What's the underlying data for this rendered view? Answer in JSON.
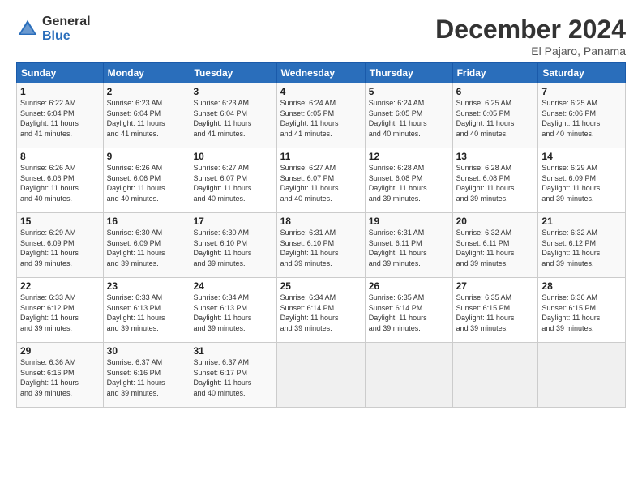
{
  "logo": {
    "general": "General",
    "blue": "Blue"
  },
  "header": {
    "month": "December 2024",
    "location": "El Pajaro, Panama"
  },
  "days_of_week": [
    "Sunday",
    "Monday",
    "Tuesday",
    "Wednesday",
    "Thursday",
    "Friday",
    "Saturday"
  ],
  "weeks": [
    [
      {
        "day": "1",
        "info": "Sunrise: 6:22 AM\nSunset: 6:04 PM\nDaylight: 11 hours\nand 41 minutes."
      },
      {
        "day": "2",
        "info": "Sunrise: 6:23 AM\nSunset: 6:04 PM\nDaylight: 11 hours\nand 41 minutes."
      },
      {
        "day": "3",
        "info": "Sunrise: 6:23 AM\nSunset: 6:04 PM\nDaylight: 11 hours\nand 41 minutes."
      },
      {
        "day": "4",
        "info": "Sunrise: 6:24 AM\nSunset: 6:05 PM\nDaylight: 11 hours\nand 41 minutes."
      },
      {
        "day": "5",
        "info": "Sunrise: 6:24 AM\nSunset: 6:05 PM\nDaylight: 11 hours\nand 40 minutes."
      },
      {
        "day": "6",
        "info": "Sunrise: 6:25 AM\nSunset: 6:05 PM\nDaylight: 11 hours\nand 40 minutes."
      },
      {
        "day": "7",
        "info": "Sunrise: 6:25 AM\nSunset: 6:06 PM\nDaylight: 11 hours\nand 40 minutes."
      }
    ],
    [
      {
        "day": "8",
        "info": "Sunrise: 6:26 AM\nSunset: 6:06 PM\nDaylight: 11 hours\nand 40 minutes."
      },
      {
        "day": "9",
        "info": "Sunrise: 6:26 AM\nSunset: 6:06 PM\nDaylight: 11 hours\nand 40 minutes."
      },
      {
        "day": "10",
        "info": "Sunrise: 6:27 AM\nSunset: 6:07 PM\nDaylight: 11 hours\nand 40 minutes."
      },
      {
        "day": "11",
        "info": "Sunrise: 6:27 AM\nSunset: 6:07 PM\nDaylight: 11 hours\nand 40 minutes."
      },
      {
        "day": "12",
        "info": "Sunrise: 6:28 AM\nSunset: 6:08 PM\nDaylight: 11 hours\nand 39 minutes."
      },
      {
        "day": "13",
        "info": "Sunrise: 6:28 AM\nSunset: 6:08 PM\nDaylight: 11 hours\nand 39 minutes."
      },
      {
        "day": "14",
        "info": "Sunrise: 6:29 AM\nSunset: 6:09 PM\nDaylight: 11 hours\nand 39 minutes."
      }
    ],
    [
      {
        "day": "15",
        "info": "Sunrise: 6:29 AM\nSunset: 6:09 PM\nDaylight: 11 hours\nand 39 minutes."
      },
      {
        "day": "16",
        "info": "Sunrise: 6:30 AM\nSunset: 6:09 PM\nDaylight: 11 hours\nand 39 minutes."
      },
      {
        "day": "17",
        "info": "Sunrise: 6:30 AM\nSunset: 6:10 PM\nDaylight: 11 hours\nand 39 minutes."
      },
      {
        "day": "18",
        "info": "Sunrise: 6:31 AM\nSunset: 6:10 PM\nDaylight: 11 hours\nand 39 minutes."
      },
      {
        "day": "19",
        "info": "Sunrise: 6:31 AM\nSunset: 6:11 PM\nDaylight: 11 hours\nand 39 minutes."
      },
      {
        "day": "20",
        "info": "Sunrise: 6:32 AM\nSunset: 6:11 PM\nDaylight: 11 hours\nand 39 minutes."
      },
      {
        "day": "21",
        "info": "Sunrise: 6:32 AM\nSunset: 6:12 PM\nDaylight: 11 hours\nand 39 minutes."
      }
    ],
    [
      {
        "day": "22",
        "info": "Sunrise: 6:33 AM\nSunset: 6:12 PM\nDaylight: 11 hours\nand 39 minutes."
      },
      {
        "day": "23",
        "info": "Sunrise: 6:33 AM\nSunset: 6:13 PM\nDaylight: 11 hours\nand 39 minutes."
      },
      {
        "day": "24",
        "info": "Sunrise: 6:34 AM\nSunset: 6:13 PM\nDaylight: 11 hours\nand 39 minutes."
      },
      {
        "day": "25",
        "info": "Sunrise: 6:34 AM\nSunset: 6:14 PM\nDaylight: 11 hours\nand 39 minutes."
      },
      {
        "day": "26",
        "info": "Sunrise: 6:35 AM\nSunset: 6:14 PM\nDaylight: 11 hours\nand 39 minutes."
      },
      {
        "day": "27",
        "info": "Sunrise: 6:35 AM\nSunset: 6:15 PM\nDaylight: 11 hours\nand 39 minutes."
      },
      {
        "day": "28",
        "info": "Sunrise: 6:36 AM\nSunset: 6:15 PM\nDaylight: 11 hours\nand 39 minutes."
      }
    ],
    [
      {
        "day": "29",
        "info": "Sunrise: 6:36 AM\nSunset: 6:16 PM\nDaylight: 11 hours\nand 39 minutes."
      },
      {
        "day": "30",
        "info": "Sunrise: 6:37 AM\nSunset: 6:16 PM\nDaylight: 11 hours\nand 39 minutes."
      },
      {
        "day": "31",
        "info": "Sunrise: 6:37 AM\nSunset: 6:17 PM\nDaylight: 11 hours\nand 40 minutes."
      },
      {
        "day": "",
        "info": ""
      },
      {
        "day": "",
        "info": ""
      },
      {
        "day": "",
        "info": ""
      },
      {
        "day": "",
        "info": ""
      }
    ]
  ]
}
